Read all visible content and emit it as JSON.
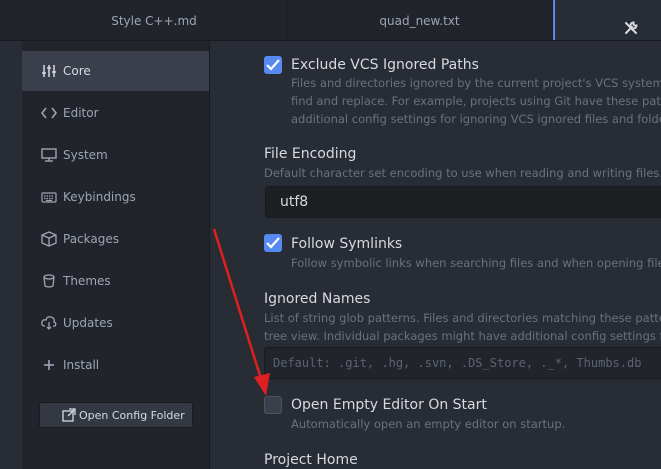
{
  "tabs": [
    {
      "label": "Style C++.md"
    },
    {
      "label": "quad_new.txt"
    }
  ],
  "sidebar": {
    "items": [
      {
        "label": "Core",
        "icon": "sliders-icon"
      },
      {
        "label": "Editor",
        "icon": "code-icon"
      },
      {
        "label": "System",
        "icon": "monitor-icon"
      },
      {
        "label": "Keybindings",
        "icon": "keyboard-icon"
      },
      {
        "label": "Packages",
        "icon": "package-icon"
      },
      {
        "label": "Themes",
        "icon": "paintcan-icon"
      },
      {
        "label": "Updates",
        "icon": "cloud-download-icon"
      },
      {
        "label": "Install",
        "icon": "plus-icon"
      }
    ],
    "open_config_label": "Open Config Folder"
  },
  "settings": {
    "exclude_vcs": {
      "title": "Exclude VCS Ignored Paths",
      "desc1": "Files and directories ignored by the current project's VCS system will b",
      "desc2": "find and replace. For example, projects using Git have these paths defi",
      "desc3": "additional config settings for ignoring VCS ignored files and folders.",
      "checked": true
    },
    "file_encoding": {
      "title": "File Encoding",
      "desc": "Default character set encoding to use when reading and writing files.",
      "value": "utf8"
    },
    "follow_symlinks": {
      "title": "Follow Symlinks",
      "desc": "Follow symbolic links when searching files and when opening files wit",
      "checked": true
    },
    "ignored_names": {
      "title": "Ignored Names",
      "desc1": "List of string glob patterns. Files and directories matching these patterns wil",
      "desc2": "tree view. Individual packages might have additional config settings for ign",
      "placeholder": "Default: .git, .hg, .svn, .DS_Store, ._*, Thumbs.db"
    },
    "open_empty_editor": {
      "title": "Open Empty Editor On Start",
      "desc": "Automatically open an empty editor on startup.",
      "checked": false
    },
    "project_home": {
      "title": "Project Home"
    }
  },
  "colors": {
    "accent": "#568af2",
    "annotation_arrow": "#e02020"
  }
}
